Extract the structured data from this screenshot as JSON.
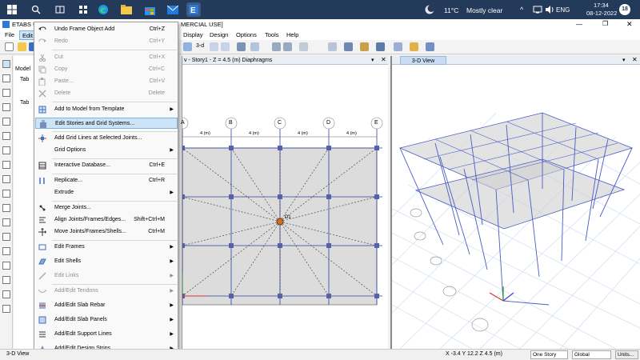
{
  "taskbar": {
    "weather_temp": "11°C",
    "weather_text": "Mostly clear",
    "language": "ENG",
    "time": "17:34",
    "date": "08-12-2022",
    "notification_count": "18"
  },
  "window": {
    "title_left": "ETABS Ult",
    "title_right": "MERCIAL USE]"
  },
  "menubar": {
    "file": "File",
    "edit": "Edit",
    "design_left": "Design",
    "design": "Design",
    "options": "Options",
    "tools": "Tools",
    "help": "Help",
    "display": "Display"
  },
  "explorer": {
    "tab_model": "Model",
    "node1": "Tab",
    "node2": "Tab"
  },
  "plan_view": {
    "title": "v - Story1 - Z = 4.5 (m)  Diaphragms",
    "grid_labels": [
      "A",
      "B",
      "C",
      "D",
      "E"
    ],
    "spacings": [
      "4 (m)",
      "4 (m)",
      "4 (m)",
      "4 (m)"
    ],
    "joint_label": "D1"
  },
  "view3d": {
    "title": "3-D View"
  },
  "edit_menu": {
    "items": [
      {
        "label": "Undo Frame Object Add",
        "shortcut": "Ctrl+Z"
      },
      {
        "label": "Redo",
        "shortcut": "Ctrl+Y"
      },
      {
        "label": "Cut",
        "shortcut": "Ctrl+X"
      },
      {
        "label": "Copy",
        "shortcut": "Ctrl+C"
      },
      {
        "label": "Paste...",
        "shortcut": "Ctrl+V"
      },
      {
        "label": "Delete",
        "shortcut": "Delete"
      },
      {
        "label": "Add to Model from Template",
        "shortcut": ""
      },
      {
        "label": "Edit Stories and Grid Systems...",
        "shortcut": ""
      },
      {
        "label": "Add Grid Lines at Selected Joints...",
        "shortcut": ""
      },
      {
        "label": "Grid Options",
        "shortcut": ""
      },
      {
        "label": "Interactive Database...",
        "shortcut": "Ctrl+E"
      },
      {
        "label": "Replicate...",
        "shortcut": "Ctrl+R"
      },
      {
        "label": "Extrude",
        "shortcut": ""
      },
      {
        "label": "Merge Joints...",
        "shortcut": ""
      },
      {
        "label": "Align Joints/Frames/Edges...",
        "shortcut": "Shift+Ctrl+M"
      },
      {
        "label": "Move Joints/Frames/Shells...",
        "shortcut": "Ctrl+M"
      },
      {
        "label": "Edit Frames",
        "shortcut": ""
      },
      {
        "label": "Edit Shells",
        "shortcut": ""
      },
      {
        "label": "Edit Links",
        "shortcut": ""
      },
      {
        "label": "Add/Edit Tendons",
        "shortcut": ""
      },
      {
        "label": "Add/Edit Slab Rebar",
        "shortcut": ""
      },
      {
        "label": "Add/Edit Slab Panels",
        "shortcut": ""
      },
      {
        "label": "Add/Edit Support Lines",
        "shortcut": ""
      },
      {
        "label": "Add/Edit Design Strips",
        "shortcut": ""
      }
    ]
  },
  "statusbar": {
    "left": "3-D View",
    "coords": "X -3.4  Y 12.2  Z 4.5 (m)",
    "story": "One Story",
    "global": "Global",
    "units": "Units..."
  },
  "colors": {
    "taskbar": "#243a5a",
    "highlight": "#cce4f7",
    "frame_blue": "#4a5bc4",
    "joint": "#5662a8"
  }
}
